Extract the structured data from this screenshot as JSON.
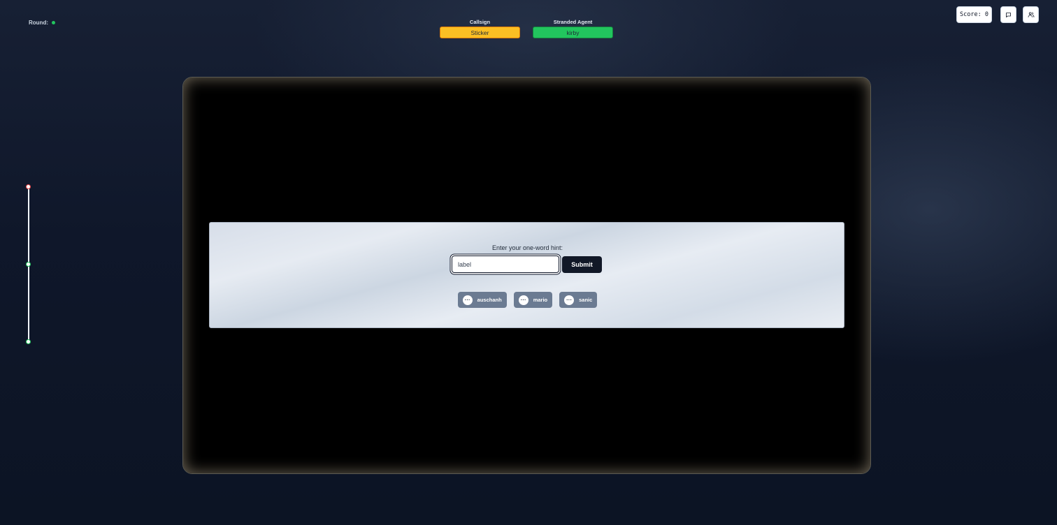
{
  "round": {
    "label": "Round:",
    "status_color": "#22c55e"
  },
  "roles": {
    "callsign": {
      "label": "Callsign",
      "value": "Sticker",
      "color": "#fbbf24"
    },
    "stranded_agent": {
      "label": "Stranded Agent",
      "value": "kirby",
      "color": "#22c55e"
    }
  },
  "toolbar": {
    "score": "Score: 0",
    "chat_icon": "chat-bubble-icon",
    "users_icon": "users-icon"
  },
  "slider": {
    "marker_colors": [
      "#ef4444",
      "#22c55e",
      "#22c55e"
    ]
  },
  "hint": {
    "prompt": "Enter your one-word hint:",
    "input_value": "label",
    "submit_label": "Submit"
  },
  "players": [
    {
      "name": "auschanh",
      "status": "typing"
    },
    {
      "name": "mario",
      "status": "typing"
    },
    {
      "name": "sanic",
      "status": "typing"
    }
  ],
  "typing_glyph": "···"
}
